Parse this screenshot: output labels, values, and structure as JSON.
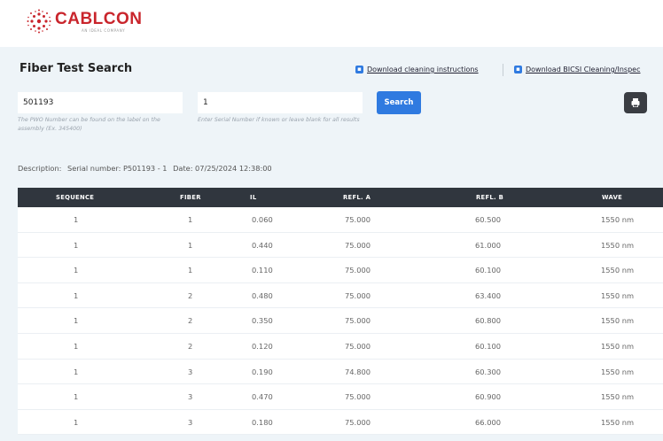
{
  "brand": {
    "name": "CABLCON",
    "tagline": "AN IDEAL COMPANY",
    "color": "#c9252c"
  },
  "page_title": "Fiber Test Search",
  "downloads": [
    {
      "label": "Download cleaning instructions",
      "icon": "pdf-icon"
    },
    {
      "label": "Download BICSI Cleaning/Inspec",
      "icon": "pdf-icon"
    }
  ],
  "pwo": {
    "value": "501193",
    "help": "The PWO Number can be found on the label on the assembly (Ex. 345400)"
  },
  "serial": {
    "value": "1",
    "help": "Enter Serial Number if known or leave blank for all results"
  },
  "search_label": "Search",
  "print_icon": "print-icon",
  "accent": "#2f7ae0",
  "description": {
    "label": "Description:",
    "serial": "Serial number: P501193 - 1",
    "date": "Date: 07/25/2024 12:38:00"
  },
  "table": {
    "columns": [
      "SEQUENCE",
      "FIBER",
      "IL",
      "REFL. A",
      "REFL. B",
      "WAVE"
    ],
    "rows": [
      [
        "1",
        "1",
        "0.060",
        "75.000",
        "60.500",
        "1550 nm"
      ],
      [
        "1",
        "1",
        "0.440",
        "75.000",
        "61.000",
        "1550 nm"
      ],
      [
        "1",
        "1",
        "0.110",
        "75.000",
        "60.100",
        "1550 nm"
      ],
      [
        "1",
        "2",
        "0.480",
        "75.000",
        "63.400",
        "1550 nm"
      ],
      [
        "1",
        "2",
        "0.350",
        "75.000",
        "60.800",
        "1550 nm"
      ],
      [
        "1",
        "2",
        "0.120",
        "75.000",
        "60.100",
        "1550 nm"
      ],
      [
        "1",
        "3",
        "0.190",
        "74.800",
        "60.300",
        "1550 nm"
      ],
      [
        "1",
        "3",
        "0.470",
        "75.000",
        "60.900",
        "1550 nm"
      ],
      [
        "1",
        "3",
        "0.180",
        "75.000",
        "66.000",
        "1550 nm"
      ]
    ]
  }
}
